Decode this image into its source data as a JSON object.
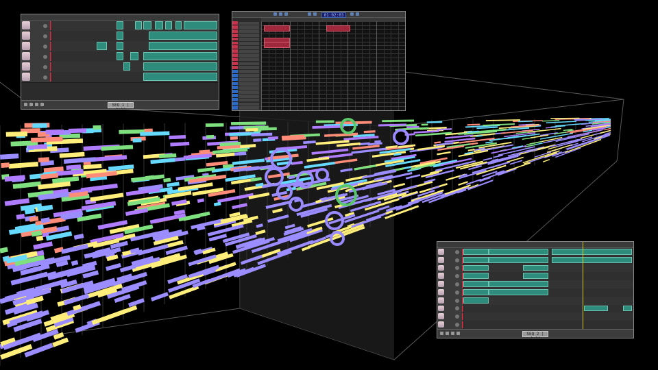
{
  "top_left_editor": {
    "tracks": 6,
    "clips": [
      [
        [
          0.39,
          0.43
        ],
        [
          0.5,
          0.54
        ],
        [
          0.55,
          0.6
        ],
        [
          0.62,
          0.67
        ],
        [
          0.68,
          0.72
        ],
        [
          0.74,
          0.78
        ],
        [
          0.79,
          0.99
        ]
      ],
      [
        [
          0.39,
          0.43
        ],
        [
          0.58,
          0.99
        ]
      ],
      [
        [
          0.27,
          0.33
        ],
        [
          0.39,
          0.43
        ],
        [
          0.58,
          0.99
        ]
      ],
      [
        [
          0.39,
          0.43
        ],
        [
          0.47,
          0.52
        ],
        [
          0.55,
          0.99
        ]
      ],
      [
        [
          0.43,
          0.47
        ],
        [
          0.55,
          0.99
        ]
      ],
      [
        [
          0.55,
          0.99
        ]
      ]
    ],
    "display_text": "SEQ 1 | 0:00"
  },
  "piano_roll": {
    "keys": 22,
    "notes": [
      {
        "row": 1,
        "start": 0.02,
        "end": 0.2
      },
      {
        "row": 1,
        "start": 0.45,
        "end": 0.62
      },
      {
        "row": 4,
        "start": 0.02,
        "end": 0.2
      },
      {
        "row": 5,
        "start": 0.02,
        "end": 0.2
      }
    ],
    "display_text": "01:02:03"
  },
  "bottom_right_editor": {
    "tracks": 10,
    "clips": [
      [
        [
          0.0,
          0.15
        ],
        [
          0.15,
          0.5
        ],
        [
          0.52,
          0.99
        ]
      ],
      [
        [
          0.0,
          0.15
        ],
        [
          0.15,
          0.5
        ],
        [
          0.52,
          0.99
        ]
      ],
      [
        [
          0.0,
          0.15
        ],
        [
          0.35,
          0.5
        ]
      ],
      [
        [
          0.0,
          0.15
        ],
        [
          0.35,
          0.5
        ]
      ],
      [
        [
          0.0,
          0.15
        ],
        [
          0.15,
          0.5
        ]
      ],
      [
        [
          0.0,
          0.15
        ],
        [
          0.15,
          0.5
        ]
      ],
      [
        [
          0.0,
          0.15
        ]
      ],
      [
        [
          0.71,
          0.85
        ],
        [
          0.94,
          0.99
        ]
      ],
      [],
      []
    ],
    "display_text": "SEQ 2 | 1:24"
  },
  "notes3d": {
    "palette": [
      "#9b8cff",
      "#ff8c78",
      "#7fe07f",
      "#66d9ff",
      "#ffef7a",
      "#b07cff"
    ],
    "circle_color": "#9a8aff",
    "highlight_circle_color": "#59c86a"
  }
}
